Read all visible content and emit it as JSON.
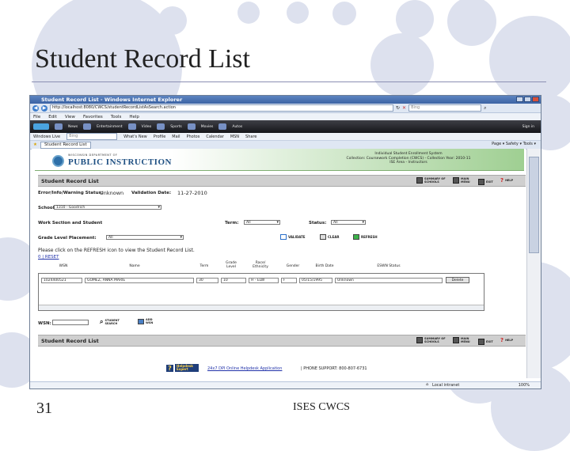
{
  "slide": {
    "title": "Student Record List",
    "number": "31",
    "footer": "ISES CWCS"
  },
  "browser": {
    "window_title": "Student Record List - Windows Internet Explorer",
    "url": "http://localhost:8080/CWCS/studentRecordListAsSearch.action",
    "search_placeholder": "Bing",
    "menu": [
      "File",
      "Edit",
      "View",
      "Favorites",
      "Tools",
      "Help"
    ],
    "toolbar1_items": [
      "News",
      "Entertainment",
      "Video",
      "Sports",
      "Movies",
      "Autos"
    ],
    "toolbar1_signin": "Sign in",
    "toolbar2": {
      "live_label": "Windows Live",
      "search_value": "Bing",
      "links": [
        "What's New",
        "Profile",
        "Mail",
        "Photos",
        "Calendar",
        "MSN",
        "Share"
      ]
    },
    "tab_label": "Student Record List",
    "tab_tools": "Page ▾  Safety ▾  Tools ▾",
    "status_zone": "Local intranet",
    "zoom": "100%"
  },
  "page": {
    "logo_small": "WISCONSIN DEPARTMENT OF",
    "logo_big": "PUBLIC INSTRUCTION",
    "system_info": [
      "Individual Student Enrollment System",
      "Collection: Coursework Completion (CWCS) - Collection Year: 2010-11",
      "ISE Area - Instructors"
    ],
    "section_title": "Student Record List",
    "nav": {
      "summary": "SUMMARY OF SCHOOLS",
      "main": "MAIN MENU",
      "exit": "EXIT",
      "help": "HELP"
    },
    "status_label": "Error/Info/Warning Status:",
    "status_value": "Unknown",
    "validation_label": "Validation Date:",
    "validation_value": "11-27-2010",
    "school_label": "School:",
    "school_value": "1310 - Goodrich",
    "work_section_label": "Work Section and Student",
    "term_label": "Term:",
    "term_value": "All",
    "status2_label": "Status:",
    "status2_value": "All",
    "grade_label": "Grade Level Placement:",
    "grade_value": "All",
    "actions": {
      "validate": "VALIDATE",
      "clear": "CLEAR",
      "refresh": "REFRESH"
    },
    "refresh_msg": "Please click on the REFRESH icon to view the Student Record List.",
    "links": "0 | RESET",
    "table": {
      "headers": [
        "WSN",
        "Name",
        "Term",
        "Grade Level",
        "Race/ Ethnicity",
        "Gender",
        "Birth Date",
        "ESWN Status"
      ],
      "row": [
        "1024400521",
        "GOMEZ, ANNA MARIE",
        "30",
        "10",
        "H - ELW",
        "F",
        "05/15/1995",
        "Unknown"
      ],
      "row_button": "Delete"
    },
    "wsn_label": "WSN:",
    "wsn_actions": {
      "search": "STUDENT SEARCH",
      "add": "ADD WSN"
    },
    "helpdesk_q": "?",
    "helpdesk_brand": "Helpdesk Expert",
    "helpdesk_link": "24x7 DPI Online Helpdesk Application",
    "helpdesk_phone": "| PHONE SUPPORT: 800-807-6731"
  },
  "colors": {
    "accent": "#1e4f82",
    "banner_green": "#9fcf92",
    "bg_circle": "#dde1ee"
  }
}
